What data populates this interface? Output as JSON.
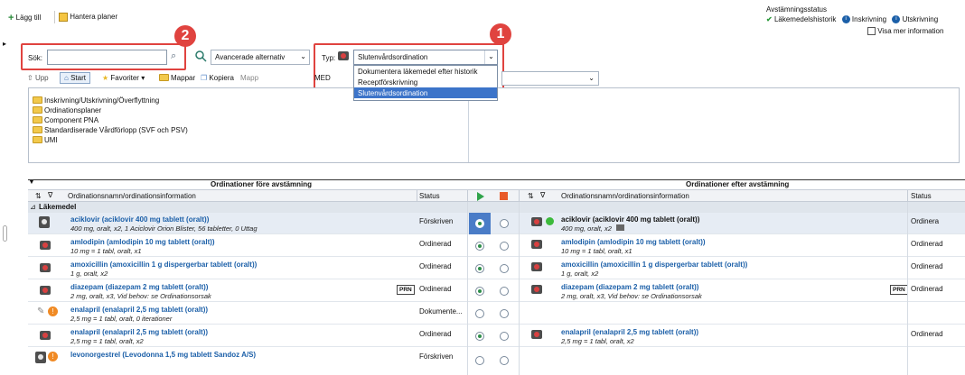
{
  "toolbar": {
    "add_label": "Lägg till",
    "manage_label": "Hantera planer"
  },
  "status": {
    "title": "Avstämningsstatus",
    "history_label": "Läkemedelshistorik",
    "inskrivning_label": "Inskrivning",
    "utskrivning_label": "Utskrivning",
    "show_more_label": "Visa mer information"
  },
  "search": {
    "label": "Sök:",
    "value": "",
    "advanced_label": "Avancerade alternativ"
  },
  "type_select": {
    "label": "Typ:",
    "selected": "Slutenvårdsordination",
    "options": [
      "Dokumentera läkemedel efter historik",
      "Receptförskrivning",
      "Slutenvårdsordination"
    ]
  },
  "nav": {
    "up": "Upp",
    "start": "Start",
    "favorites": "Favoriter",
    "folders": "Mappar",
    "copy": "Kopiera",
    "mapp": "Mapp",
    "med": "MED"
  },
  "folders": [
    "Inskrivning/Utskrivning/Överflyttning",
    "Ordinationsplaner",
    "Component PNA",
    "Standardiserade Vårdförlopp (SVF och PSV)",
    "UMI"
  ],
  "badges": [
    "2",
    "1"
  ],
  "reconciliation": {
    "before_title": "Ordinationer före avstämning",
    "after_title": "Ordinationer efter avstämning",
    "col_name": "Ordinationsnamn/ordinationsinformation",
    "col_status": "Status",
    "group": "Läkemedel",
    "rows": [
      {
        "before_name": "aciklovir (aciklovir 400 mg tablett (oralt))",
        "before_detail": "400 mg, oralt, x2, 1 Aciclovir Orion Blister, 56 tabletter, 0 Uttag",
        "before_status": "Förskriven",
        "after_name": "aciklovir (aciklovir 400 mg tablett (oralt))",
        "after_detail": "400 mg, oralt, x2",
        "after_status": "Ordinera"
      },
      {
        "before_name": "amlodipin (amlodipin 10 mg tablett (oralt))",
        "before_detail": "10 mg = 1 tabl, oralt, x1",
        "before_status": "Ordinerad",
        "after_name": "amlodipin (amlodipin 10 mg tablett (oralt))",
        "after_detail": "10 mg = 1 tabl, oralt, x1",
        "after_status": "Ordinerad"
      },
      {
        "before_name": "amoxicillin (amoxicillin 1 g dispergerbar tablett (oralt))",
        "before_detail": "1 g, oralt, x2",
        "before_status": "Ordinerad",
        "after_name": "amoxicillin (amoxicillin 1 g dispergerbar tablett (oralt))",
        "after_detail": "1 g, oralt, x2",
        "after_status": "Ordinerad"
      },
      {
        "before_name": "diazepam (diazepam 2 mg tablett (oralt))",
        "before_detail": "2 mg, oralt, x3, Vid behov: se Ordinationsorsak",
        "before_status": "Ordinerad",
        "prn": "PRN",
        "after_name": "diazepam (diazepam 2 mg tablett (oralt))",
        "after_detail": "2 mg, oralt, x3, Vid behov: se Ordinationsorsak",
        "after_status": "Ordinerad"
      },
      {
        "before_name": "enalapril (enalapril 2,5 mg tablett (oralt))",
        "before_detail": "2,5 mg = 1 tabl, oralt, 0 iterationer",
        "before_status": "Dokumente..."
      },
      {
        "before_name": "enalapril (enalapril 2,5 mg tablett (oralt))",
        "before_detail": "2,5 mg = 1 tabl, oralt, x2",
        "before_status": "Ordinerad",
        "after_name": "enalapril (enalapril 2,5 mg tablett (oralt))",
        "after_detail": "2,5 mg = 1 tabl, oralt, x2",
        "after_status": "Ordinerad"
      },
      {
        "before_name": "levonorgestrel (Levodonna 1,5 mg tablett Sandoz A/S)",
        "before_status": "Förskriven"
      }
    ]
  },
  "colors": {
    "link": "#1b5fa8",
    "highlight": "#e0433f",
    "selection": "#3c74c9"
  }
}
